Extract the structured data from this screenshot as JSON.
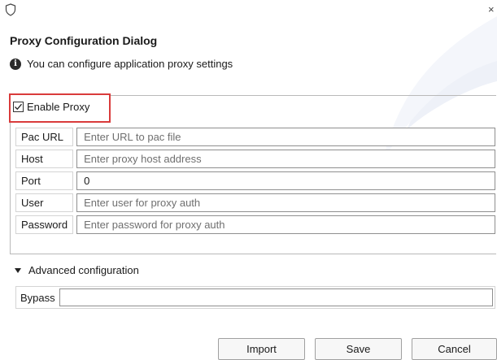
{
  "window": {
    "close_glyph": "×"
  },
  "dialog": {
    "title": "Proxy Configuration Dialog",
    "info_text": "You can configure application proxy settings"
  },
  "proxy": {
    "enable_label": "Enable Proxy",
    "enabled": true,
    "fields": [
      {
        "label": "Pac URL",
        "value": "",
        "placeholder": "Enter URL to pac file"
      },
      {
        "label": "Host",
        "value": "",
        "placeholder": "Enter proxy host address"
      },
      {
        "label": "Port",
        "value": "0",
        "placeholder": ""
      },
      {
        "label": "User",
        "value": "",
        "placeholder": "Enter user for proxy auth"
      },
      {
        "label": "Password",
        "value": "",
        "placeholder": "Enter password for proxy auth"
      }
    ]
  },
  "advanced": {
    "label": "Advanced configuration",
    "expanded": true,
    "bypass_label": "Bypass",
    "bypass_value": ""
  },
  "buttons": {
    "import": "Import",
    "save": "Save",
    "cancel": "Cancel"
  },
  "colors": {
    "highlight": "#d93b3b",
    "border": "#8f8f8f",
    "background": "#ffffff"
  },
  "icons": [
    "shield-icon",
    "close-icon",
    "info-icon",
    "checkbox-check-icon",
    "expand-triangle-icon"
  ]
}
